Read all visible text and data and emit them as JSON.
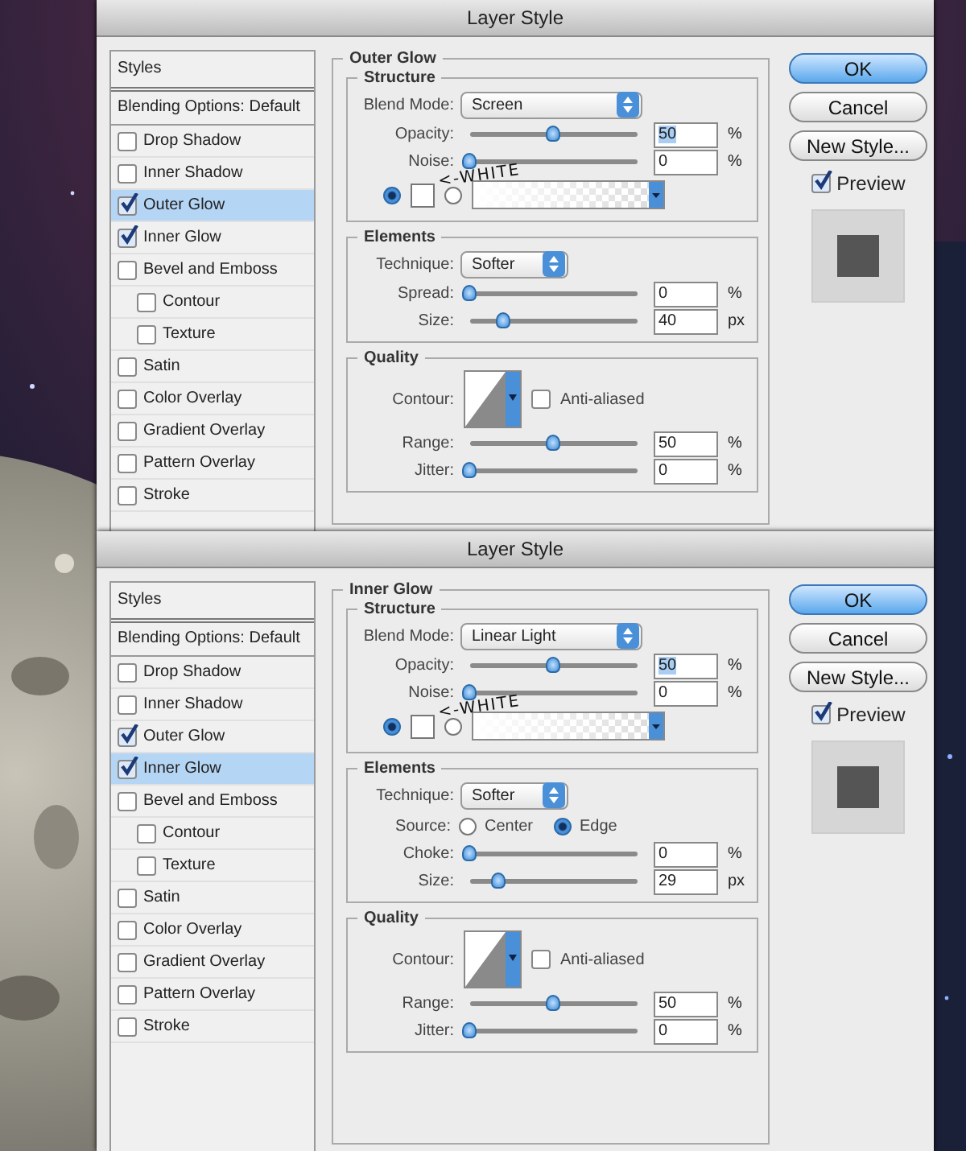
{
  "dialogs": [
    {
      "title": "Layer Style",
      "styles_header": "Styles",
      "blending_options": "Blending Options: Default",
      "styles": [
        {
          "label": "Drop Shadow",
          "checked": false,
          "selected": false
        },
        {
          "label": "Inner Shadow",
          "checked": false,
          "selected": false
        },
        {
          "label": "Outer Glow",
          "checked": true,
          "selected": true
        },
        {
          "label": "Inner Glow",
          "checked": true,
          "selected": false
        },
        {
          "label": "Bevel and Emboss",
          "checked": false,
          "selected": false,
          "children": [
            {
              "label": "Contour",
              "checked": false,
              "selected": false
            },
            {
              "label": "Texture",
              "checked": false,
              "selected": false
            }
          ]
        },
        {
          "label": "Satin",
          "checked": false,
          "selected": false
        },
        {
          "label": "Color Overlay",
          "checked": false,
          "selected": false
        },
        {
          "label": "Gradient Overlay",
          "checked": false,
          "selected": false
        },
        {
          "label": "Pattern Overlay",
          "checked": false,
          "selected": false
        },
        {
          "label": "Stroke",
          "checked": false,
          "selected": false
        }
      ],
      "panel": {
        "title": "Outer Glow",
        "structure": {
          "title": "Structure",
          "blend_mode": {
            "label": "Blend Mode:",
            "value": "Screen"
          },
          "sliders": [
            {
              "label": "Opacity:",
              "level": 0.5,
              "value": "50",
              "unit": "%",
              "focused": true
            },
            {
              "label": "Noise:",
              "level": 0,
              "value": "0",
              "unit": "%",
              "focused": false
            }
          ],
          "fill_options": [
            {
              "kind": "color",
              "selected": true
            },
            {
              "kind": "gradient",
              "selected": false
            }
          ],
          "annotation": "<-WHITE"
        },
        "elements": {
          "title": "Elements",
          "technique": {
            "label": "Technique:",
            "value": "Softer"
          },
          "sliders": [
            {
              "label": "Spread:",
              "level": 0,
              "value": "0",
              "unit": "%",
              "focused": false
            },
            {
              "label": "Size:",
              "level": 0.2,
              "value": "40",
              "unit": "px",
              "focused": false
            }
          ]
        },
        "quality": {
          "title": "Quality",
          "contour_label": "Contour:",
          "anti_aliased": {
            "label": "Anti-aliased",
            "checked": false
          },
          "sliders": [
            {
              "label": "Range:",
              "level": 0.5,
              "value": "50",
              "unit": "%",
              "focused": false
            },
            {
              "label": "Jitter:",
              "level": 0,
              "value": "0",
              "unit": "%",
              "focused": false
            }
          ]
        }
      },
      "buttons": [
        {
          "label": "OK",
          "default": true
        },
        {
          "label": "Cancel",
          "default": false
        },
        {
          "label": "New Style...",
          "default": false
        }
      ],
      "preview": {
        "label": "Preview",
        "checked": true
      }
    },
    {
      "title": "Layer Style",
      "styles_header": "Styles",
      "blending_options": "Blending Options: Default",
      "styles": [
        {
          "label": "Drop Shadow",
          "checked": false,
          "selected": false
        },
        {
          "label": "Inner Shadow",
          "checked": false,
          "selected": false
        },
        {
          "label": "Outer Glow",
          "checked": true,
          "selected": false
        },
        {
          "label": "Inner Glow",
          "checked": true,
          "selected": true
        },
        {
          "label": "Bevel and Emboss",
          "checked": false,
          "selected": false,
          "children": [
            {
              "label": "Contour",
              "checked": false,
              "selected": false
            },
            {
              "label": "Texture",
              "checked": false,
              "selected": false
            }
          ]
        },
        {
          "label": "Satin",
          "checked": false,
          "selected": false
        },
        {
          "label": "Color Overlay",
          "checked": false,
          "selected": false
        },
        {
          "label": "Gradient Overlay",
          "checked": false,
          "selected": false
        },
        {
          "label": "Pattern Overlay",
          "checked": false,
          "selected": false
        },
        {
          "label": "Stroke",
          "checked": false,
          "selected": false
        }
      ],
      "panel": {
        "title": "Inner Glow",
        "structure": {
          "title": "Structure",
          "blend_mode": {
            "label": "Blend Mode:",
            "value": "Linear Light"
          },
          "sliders": [
            {
              "label": "Opacity:",
              "level": 0.5,
              "value": "50",
              "unit": "%",
              "focused": true
            },
            {
              "label": "Noise:",
              "level": 0,
              "value": "0",
              "unit": "%",
              "focused": false
            }
          ],
          "fill_options": [
            {
              "kind": "color",
              "selected": true
            },
            {
              "kind": "gradient",
              "selected": false
            }
          ],
          "annotation": "<-WHITE"
        },
        "elements": {
          "title": "Elements",
          "technique": {
            "label": "Technique:",
            "value": "Softer"
          },
          "source": {
            "label": "Source:",
            "options": [
              {
                "label": "Center",
                "selected": false
              },
              {
                "label": "Edge",
                "selected": true
              }
            ]
          },
          "sliders": [
            {
              "label": "Choke:",
              "level": 0,
              "value": "0",
              "unit": "%",
              "focused": false
            },
            {
              "label": "Size:",
              "level": 0.17,
              "value": "29",
              "unit": "px",
              "focused": false
            }
          ]
        },
        "quality": {
          "title": "Quality",
          "contour_label": "Contour:",
          "anti_aliased": {
            "label": "Anti-aliased",
            "checked": false
          },
          "sliders": [
            {
              "label": "Range:",
              "level": 0.5,
              "value": "50",
              "unit": "%",
              "focused": false
            },
            {
              "label": "Jitter:",
              "level": 0,
              "value": "0",
              "unit": "%",
              "focused": false
            }
          ]
        }
      },
      "buttons": [
        {
          "label": "OK",
          "default": true
        },
        {
          "label": "Cancel",
          "default": false
        },
        {
          "label": "New Style...",
          "default": false
        }
      ],
      "preview": {
        "label": "Preview",
        "checked": true
      }
    }
  ]
}
